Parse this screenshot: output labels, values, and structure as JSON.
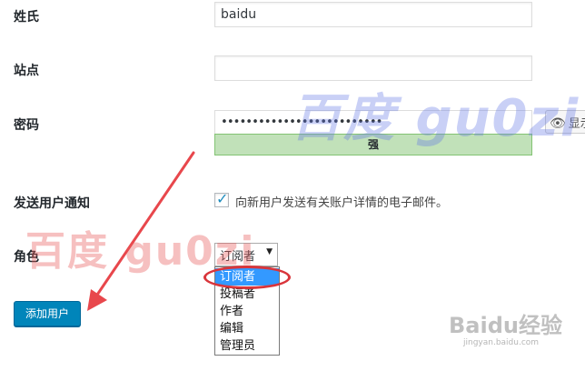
{
  "form": {
    "last_name": {
      "label": "姓氏",
      "value": "baidu"
    },
    "website": {
      "label": "站点",
      "value": ""
    },
    "password": {
      "label": "密码",
      "value": "••••••••••••••••••••••••••",
      "strength": "强",
      "show_button": "显示"
    },
    "notify": {
      "label": "发送用户通知",
      "checked": true,
      "text": "向新用户发送有关账户详情的电子邮件。"
    },
    "role": {
      "label": "角色",
      "selected": "订阅者",
      "options": [
        "订阅者",
        "投稿者",
        "作者",
        "编辑",
        "管理员"
      ],
      "highlighted_index": 0
    },
    "submit_label": "添加用户"
  },
  "watermarks": {
    "right": "百度 gu0zi",
    "left": "百度 gu0zi",
    "logo": "Baidu经验",
    "url": "jingyan.baidu.com"
  },
  "colors": {
    "button_blue": "#0085ba",
    "strength_green": "#c1e1b9",
    "annotation_red": "#d9353b",
    "option_highlight": "#3399ff"
  }
}
